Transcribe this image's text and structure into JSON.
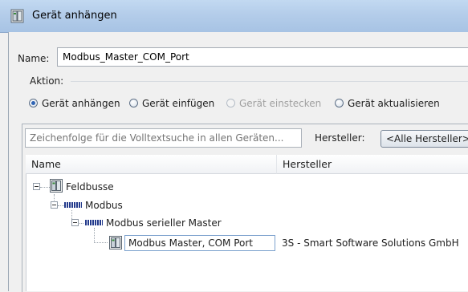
{
  "window": {
    "title": "Gerät anhängen",
    "icon": "device-folder-icon"
  },
  "form": {
    "name_label": "Name:",
    "name_value": "Modbus_Master_COM_Port",
    "action_label": "Aktion:",
    "actions": [
      {
        "label": "Gerät anhängen",
        "selected": true,
        "enabled": true
      },
      {
        "label": "Gerät einfügen",
        "selected": false,
        "enabled": true
      },
      {
        "label": "Gerät einstecken",
        "selected": false,
        "enabled": false
      },
      {
        "label": "Gerät aktualisieren",
        "selected": false,
        "enabled": true
      }
    ]
  },
  "search": {
    "placeholder": "Zeichenfolge für die Volltextsuche in allen Geräten...",
    "vendor_label": "Hersteller:",
    "vendor_value": "<Alle Hersteller>"
  },
  "list": {
    "columns": [
      "Name",
      "Hersteller"
    ],
    "tree": [
      {
        "label": "Feldbusse",
        "icon": "device-folder-icon",
        "vendor": ""
      },
      {
        "label": "Modbus",
        "icon": "modbus-logo-icon",
        "vendor": ""
      },
      {
        "label": "Modbus serieller Master",
        "icon": "modbus-logo-icon",
        "vendor": ""
      },
      {
        "label": "Modbus Master, COM Port",
        "icon": "device-icon",
        "vendor": "3S - Smart Software Solutions GmbH",
        "selected": true
      }
    ]
  }
}
